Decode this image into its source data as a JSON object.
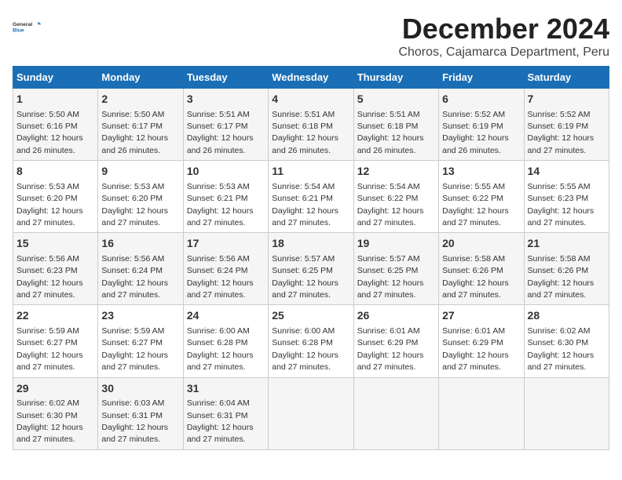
{
  "logo": {
    "general": "General",
    "blue": "Blue"
  },
  "title": "December 2024",
  "subtitle": "Choros, Cajamarca Department, Peru",
  "days_header": [
    "Sunday",
    "Monday",
    "Tuesday",
    "Wednesday",
    "Thursday",
    "Friday",
    "Saturday"
  ],
  "weeks": [
    [
      {
        "day": "1",
        "sunrise": "5:50 AM",
        "sunset": "6:16 PM",
        "daylight": "12 hours and 26 minutes."
      },
      {
        "day": "2",
        "sunrise": "5:50 AM",
        "sunset": "6:17 PM",
        "daylight": "12 hours and 26 minutes."
      },
      {
        "day": "3",
        "sunrise": "5:51 AM",
        "sunset": "6:17 PM",
        "daylight": "12 hours and 26 minutes."
      },
      {
        "day": "4",
        "sunrise": "5:51 AM",
        "sunset": "6:18 PM",
        "daylight": "12 hours and 26 minutes."
      },
      {
        "day": "5",
        "sunrise": "5:51 AM",
        "sunset": "6:18 PM",
        "daylight": "12 hours and 26 minutes."
      },
      {
        "day": "6",
        "sunrise": "5:52 AM",
        "sunset": "6:19 PM",
        "daylight": "12 hours and 26 minutes."
      },
      {
        "day": "7",
        "sunrise": "5:52 AM",
        "sunset": "6:19 PM",
        "daylight": "12 hours and 27 minutes."
      }
    ],
    [
      {
        "day": "8",
        "sunrise": "5:53 AM",
        "sunset": "6:20 PM",
        "daylight": "12 hours and 27 minutes."
      },
      {
        "day": "9",
        "sunrise": "5:53 AM",
        "sunset": "6:20 PM",
        "daylight": "12 hours and 27 minutes."
      },
      {
        "day": "10",
        "sunrise": "5:53 AM",
        "sunset": "6:21 PM",
        "daylight": "12 hours and 27 minutes."
      },
      {
        "day": "11",
        "sunrise": "5:54 AM",
        "sunset": "6:21 PM",
        "daylight": "12 hours and 27 minutes."
      },
      {
        "day": "12",
        "sunrise": "5:54 AM",
        "sunset": "6:22 PM",
        "daylight": "12 hours and 27 minutes."
      },
      {
        "day": "13",
        "sunrise": "5:55 AM",
        "sunset": "6:22 PM",
        "daylight": "12 hours and 27 minutes."
      },
      {
        "day": "14",
        "sunrise": "5:55 AM",
        "sunset": "6:23 PM",
        "daylight": "12 hours and 27 minutes."
      }
    ],
    [
      {
        "day": "15",
        "sunrise": "5:56 AM",
        "sunset": "6:23 PM",
        "daylight": "12 hours and 27 minutes."
      },
      {
        "day": "16",
        "sunrise": "5:56 AM",
        "sunset": "6:24 PM",
        "daylight": "12 hours and 27 minutes."
      },
      {
        "day": "17",
        "sunrise": "5:56 AM",
        "sunset": "6:24 PM",
        "daylight": "12 hours and 27 minutes."
      },
      {
        "day": "18",
        "sunrise": "5:57 AM",
        "sunset": "6:25 PM",
        "daylight": "12 hours and 27 minutes."
      },
      {
        "day": "19",
        "sunrise": "5:57 AM",
        "sunset": "6:25 PM",
        "daylight": "12 hours and 27 minutes."
      },
      {
        "day": "20",
        "sunrise": "5:58 AM",
        "sunset": "6:26 PM",
        "daylight": "12 hours and 27 minutes."
      },
      {
        "day": "21",
        "sunrise": "5:58 AM",
        "sunset": "6:26 PM",
        "daylight": "12 hours and 27 minutes."
      }
    ],
    [
      {
        "day": "22",
        "sunrise": "5:59 AM",
        "sunset": "6:27 PM",
        "daylight": "12 hours and 27 minutes."
      },
      {
        "day": "23",
        "sunrise": "5:59 AM",
        "sunset": "6:27 PM",
        "daylight": "12 hours and 27 minutes."
      },
      {
        "day": "24",
        "sunrise": "6:00 AM",
        "sunset": "6:28 PM",
        "daylight": "12 hours and 27 minutes."
      },
      {
        "day": "25",
        "sunrise": "6:00 AM",
        "sunset": "6:28 PM",
        "daylight": "12 hours and 27 minutes."
      },
      {
        "day": "26",
        "sunrise": "6:01 AM",
        "sunset": "6:29 PM",
        "daylight": "12 hours and 27 minutes."
      },
      {
        "day": "27",
        "sunrise": "6:01 AM",
        "sunset": "6:29 PM",
        "daylight": "12 hours and 27 minutes."
      },
      {
        "day": "28",
        "sunrise": "6:02 AM",
        "sunset": "6:30 PM",
        "daylight": "12 hours and 27 minutes."
      }
    ],
    [
      {
        "day": "29",
        "sunrise": "6:02 AM",
        "sunset": "6:30 PM",
        "daylight": "12 hours and 27 minutes."
      },
      {
        "day": "30",
        "sunrise": "6:03 AM",
        "sunset": "6:31 PM",
        "daylight": "12 hours and 27 minutes."
      },
      {
        "day": "31",
        "sunrise": "6:04 AM",
        "sunset": "6:31 PM",
        "daylight": "12 hours and 27 minutes."
      },
      null,
      null,
      null,
      null
    ]
  ],
  "labels": {
    "sunrise": "Sunrise:",
    "sunset": "Sunset:",
    "daylight": "Daylight:"
  }
}
